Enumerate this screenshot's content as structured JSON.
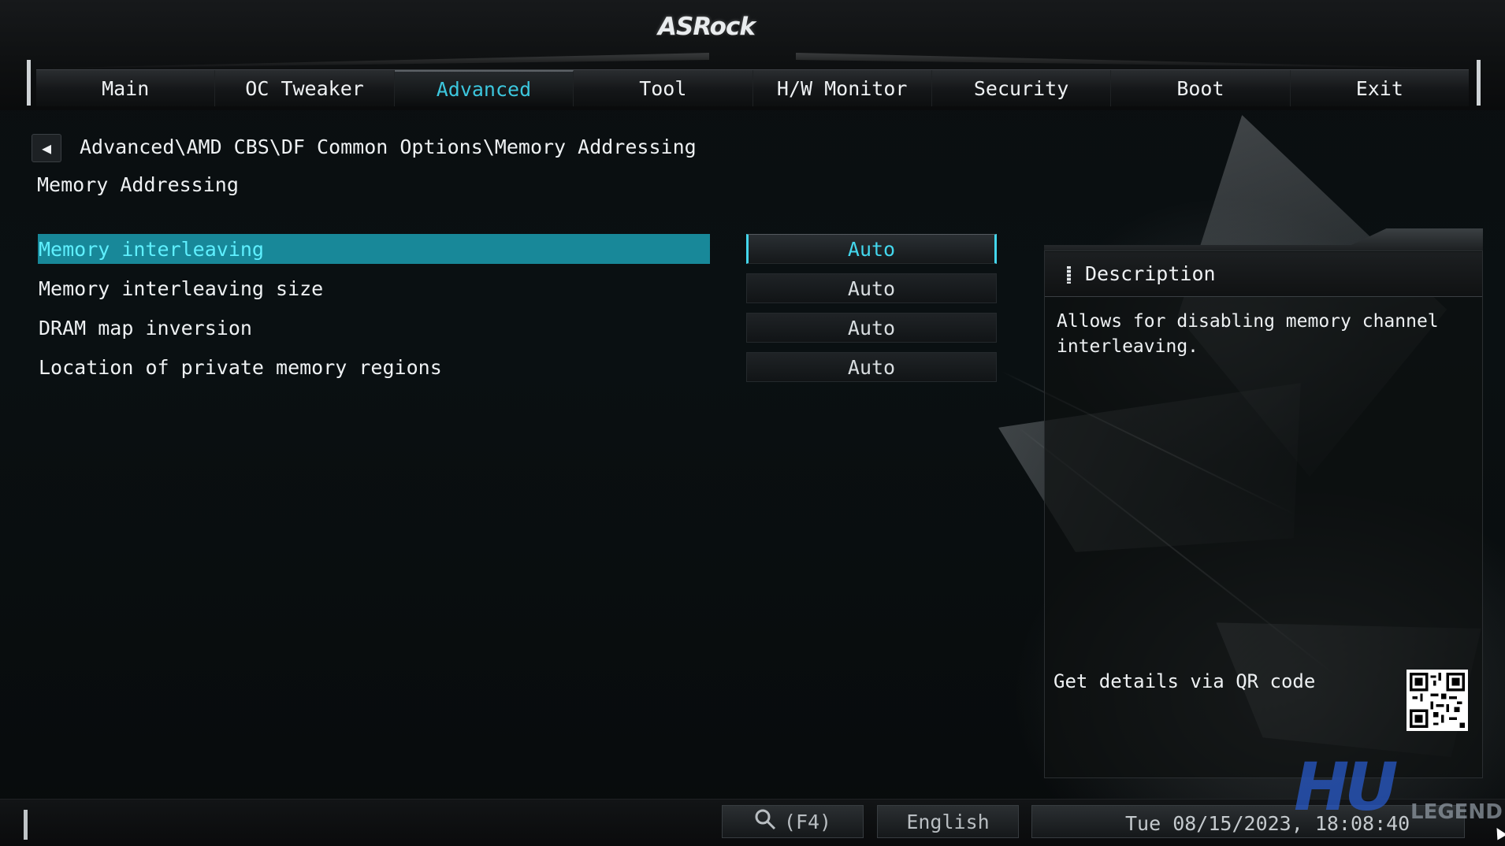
{
  "brand": "ASRock",
  "tabs": [
    {
      "label": "Main"
    },
    {
      "label": "OC Tweaker"
    },
    {
      "label": "Advanced"
    },
    {
      "label": "Tool"
    },
    {
      "label": "H/W Monitor"
    },
    {
      "label": "Security"
    },
    {
      "label": "Boot"
    },
    {
      "label": "Exit"
    }
  ],
  "active_tab": "Advanced",
  "breadcrumb": "Advanced\\AMD CBS\\DF Common Options\\Memory Addressing",
  "page_title": "Memory Addressing",
  "settings": [
    {
      "label": "Memory interleaving",
      "value": "Auto",
      "selected": true
    },
    {
      "label": "Memory interleaving size",
      "value": "Auto",
      "selected": false
    },
    {
      "label": "DRAM map inversion",
      "value": "Auto",
      "selected": false
    },
    {
      "label": "Location of private memory regions",
      "value": "Auto",
      "selected": false
    }
  ],
  "description": {
    "title": "Description",
    "text": "Allows for disabling memory channel interleaving.",
    "qr_label": "Get details via QR code"
  },
  "footer": {
    "search_label": "(F4)",
    "language": "English",
    "datetime": "Tue 08/15/2023, 18:08:40"
  },
  "watermark": {
    "mark": "HU",
    "text": "LEGEND"
  },
  "colors": {
    "accent": "#3cc6dd",
    "selected_row_bg": "#188899",
    "background": "#0a0d0f"
  }
}
